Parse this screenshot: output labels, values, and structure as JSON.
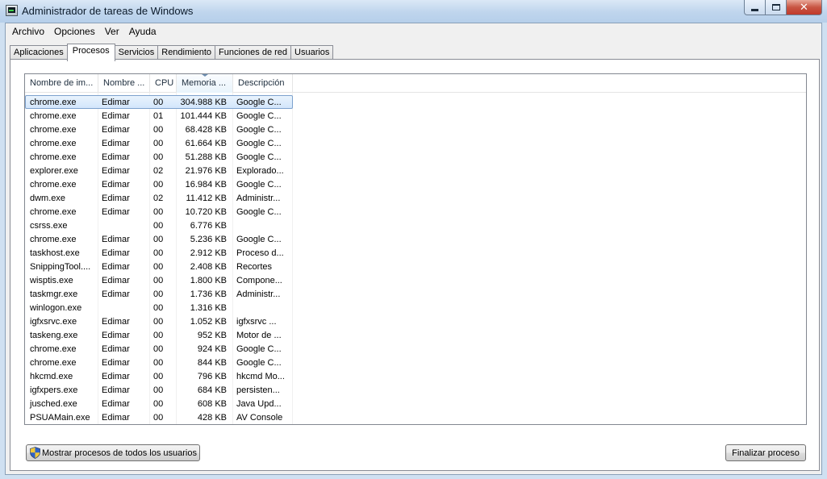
{
  "window": {
    "title": "Administrador de tareas de Windows"
  },
  "menu": [
    "Archivo",
    "Opciones",
    "Ver",
    "Ayuda"
  ],
  "tabs": [
    "Aplicaciones",
    "Procesos",
    "Servicios",
    "Rendimiento",
    "Funciones de red",
    "Usuarios"
  ],
  "active_tab": "Procesos",
  "columns": {
    "name": "Nombre de im...",
    "user": "Nombre ...",
    "cpu": "CPU",
    "memory": "Memoria ...",
    "description": "Descripción"
  },
  "sorted_column": "memory",
  "processes": [
    {
      "name": "chrome.exe",
      "user": "Edimar",
      "cpu": "00",
      "memory": "304.988 KB",
      "description": "Google C..."
    },
    {
      "name": "chrome.exe",
      "user": "Edimar",
      "cpu": "01",
      "memory": "101.444 KB",
      "description": "Google C..."
    },
    {
      "name": "chrome.exe",
      "user": "Edimar",
      "cpu": "00",
      "memory": "68.428 KB",
      "description": "Google C..."
    },
    {
      "name": "chrome.exe",
      "user": "Edimar",
      "cpu": "00",
      "memory": "61.664 KB",
      "description": "Google C..."
    },
    {
      "name": "chrome.exe",
      "user": "Edimar",
      "cpu": "00",
      "memory": "51.288 KB",
      "description": "Google C..."
    },
    {
      "name": "explorer.exe",
      "user": "Edimar",
      "cpu": "02",
      "memory": "21.976 KB",
      "description": "Explorado..."
    },
    {
      "name": "chrome.exe",
      "user": "Edimar",
      "cpu": "00",
      "memory": "16.984 KB",
      "description": "Google C..."
    },
    {
      "name": "dwm.exe",
      "user": "Edimar",
      "cpu": "02",
      "memory": "11.412 KB",
      "description": "Administr..."
    },
    {
      "name": "chrome.exe",
      "user": "Edimar",
      "cpu": "00",
      "memory": "10.720 KB",
      "description": "Google C..."
    },
    {
      "name": "csrss.exe",
      "user": "",
      "cpu": "00",
      "memory": "6.776 KB",
      "description": ""
    },
    {
      "name": "chrome.exe",
      "user": "Edimar",
      "cpu": "00",
      "memory": "5.236 KB",
      "description": "Google C..."
    },
    {
      "name": "taskhost.exe",
      "user": "Edimar",
      "cpu": "00",
      "memory": "2.912 KB",
      "description": "Proceso d..."
    },
    {
      "name": "SnippingTool....",
      "user": "Edimar",
      "cpu": "00",
      "memory": "2.408 KB",
      "description": "Recortes"
    },
    {
      "name": "wisptis.exe",
      "user": "Edimar",
      "cpu": "00",
      "memory": "1.800 KB",
      "description": "Compone..."
    },
    {
      "name": "taskmgr.exe",
      "user": "Edimar",
      "cpu": "00",
      "memory": "1.736 KB",
      "description": "Administr..."
    },
    {
      "name": "winlogon.exe",
      "user": "",
      "cpu": "00",
      "memory": "1.316 KB",
      "description": ""
    },
    {
      "name": "igfxsrvc.exe",
      "user": "Edimar",
      "cpu": "00",
      "memory": "1.052 KB",
      "description": "igfxsrvc ..."
    },
    {
      "name": "taskeng.exe",
      "user": "Edimar",
      "cpu": "00",
      "memory": "952 KB",
      "description": "Motor de ..."
    },
    {
      "name": "chrome.exe",
      "user": "Edimar",
      "cpu": "00",
      "memory": "924 KB",
      "description": "Google C..."
    },
    {
      "name": "chrome.exe",
      "user": "Edimar",
      "cpu": "00",
      "memory": "844 KB",
      "description": "Google C..."
    },
    {
      "name": "hkcmd.exe",
      "user": "Edimar",
      "cpu": "00",
      "memory": "796 KB",
      "description": "hkcmd Mo..."
    },
    {
      "name": "igfxpers.exe",
      "user": "Edimar",
      "cpu": "00",
      "memory": "684 KB",
      "description": "persisten..."
    },
    {
      "name": "jusched.exe",
      "user": "Edimar",
      "cpu": "00",
      "memory": "608 KB",
      "description": "Java Upd..."
    },
    {
      "name": "PSUAMain.exe",
      "user": "Edimar",
      "cpu": "00",
      "memory": "428 KB",
      "description": "AV Console"
    }
  ],
  "selected_row": 0,
  "buttons": {
    "show_all": "Mostrar procesos de todos los usuarios",
    "end_process": "Finalizar proceso"
  },
  "icons": {
    "window": "task-manager-icon",
    "show_all": "uac-shield-icon"
  }
}
